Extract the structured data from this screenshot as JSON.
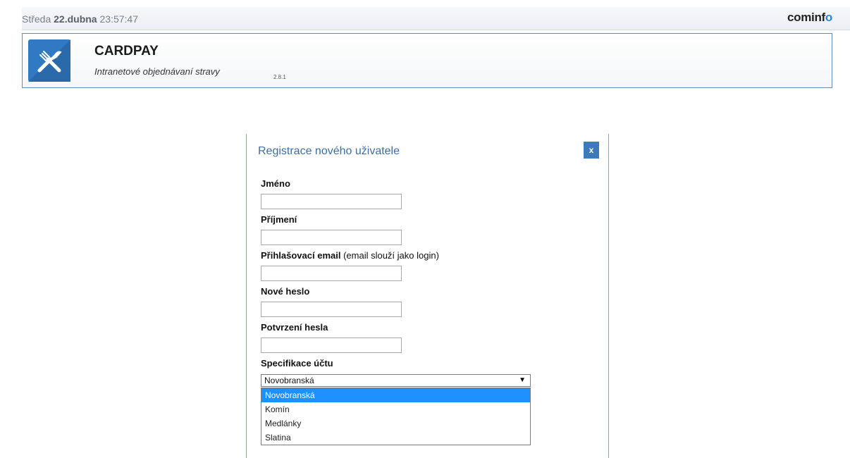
{
  "topbar": {
    "day": "Středa",
    "date_bold": "22.dubna",
    "time": "23:57:47",
    "brand_main": "cominf",
    "brand_accent": "o"
  },
  "header": {
    "logo_icon": "fork-knife-icon",
    "title": "CARDPAY",
    "subtitle": "Intranetové objednávaní stravy",
    "version": "2.8.1"
  },
  "modal": {
    "title": "Registrace nového uživatele",
    "close_label": "x",
    "fields": [
      {
        "label": "Jméno",
        "hint": "",
        "value": ""
      },
      {
        "label": "Příjmení",
        "hint": "",
        "value": ""
      },
      {
        "label": "Přihlašovací email",
        "hint": "(email slouží jako login)",
        "value": ""
      },
      {
        "label": "Nové heslo",
        "hint": "",
        "value": ""
      },
      {
        "label": "Potvrzení hesla",
        "hint": "",
        "value": ""
      }
    ],
    "account_spec": {
      "label": "Specifikace účtu",
      "selected": "Novobranská",
      "options": [
        "Novobranská",
        "Komín",
        "Medlánky",
        "Slatina"
      ]
    }
  },
  "colors": {
    "accent": "#3e79b8",
    "selection": "#1e90ff"
  }
}
